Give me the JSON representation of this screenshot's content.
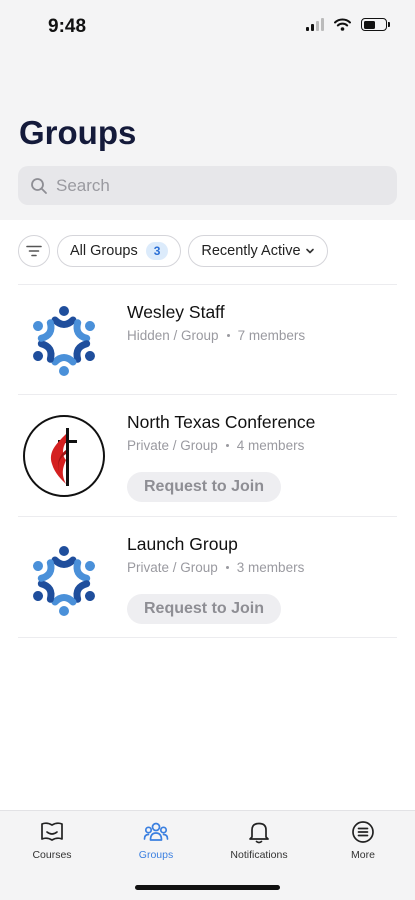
{
  "status_bar": {
    "time": "9:48"
  },
  "header": {
    "title": "Groups"
  },
  "search": {
    "placeholder": "Search"
  },
  "filters": {
    "all_groups_label": "All Groups",
    "all_groups_count": "3",
    "sort_label": "Recently Active"
  },
  "groups": [
    {
      "name": "Wesley Staff",
      "visibility": "Hidden / Group",
      "members": "7 members",
      "action": ""
    },
    {
      "name": "North Texas Conference",
      "visibility": "Private / Group",
      "members": "4 members",
      "action": "Request to Join"
    },
    {
      "name": "Launch Group",
      "visibility": "Private / Group",
      "members": "3 members",
      "action": "Request to Join"
    }
  ],
  "tabbar": {
    "items": [
      {
        "label": "Courses",
        "icon": "courses-icon"
      },
      {
        "label": "Groups",
        "icon": "groups-icon"
      },
      {
        "label": "Notifications",
        "icon": "bell-icon"
      },
      {
        "label": "More",
        "icon": "more-icon"
      }
    ],
    "active_color": "#3a7fe0"
  },
  "colors": {
    "accent": "#3a7fe0",
    "title": "#141a3a",
    "badge_bg": "#dcebfb"
  }
}
